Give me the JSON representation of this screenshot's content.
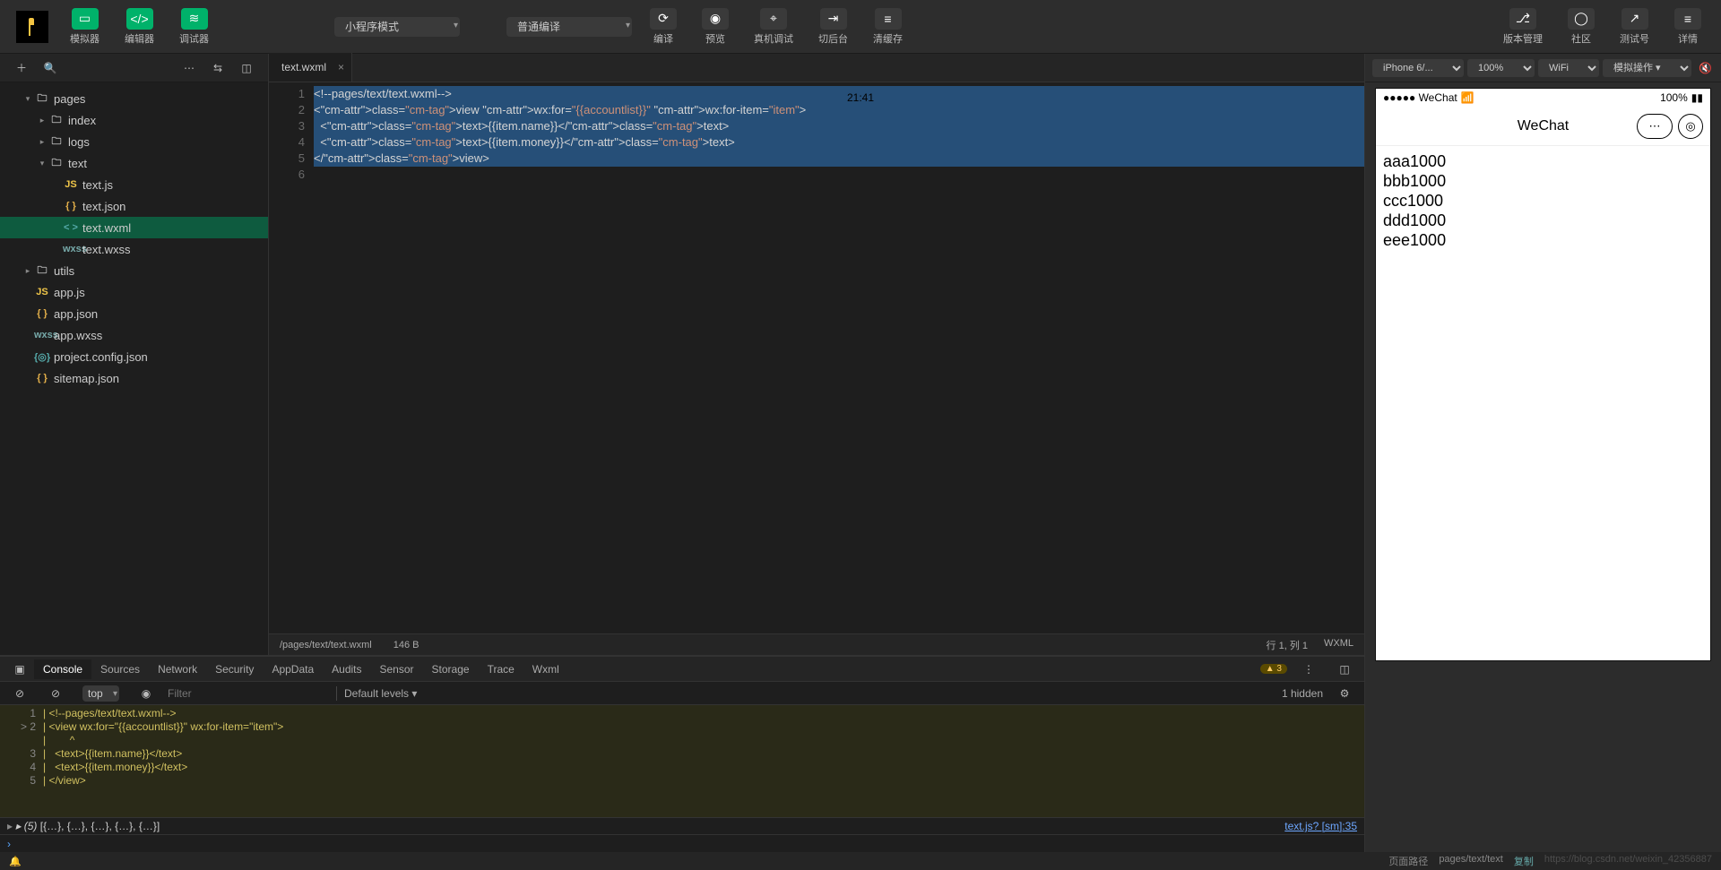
{
  "toolbar": {
    "simulator": "模拟器",
    "editor": "编辑器",
    "debugger": "调试器",
    "mode": "小程序模式",
    "compile_mode": "普通编译",
    "compile": "编译",
    "preview": "预览",
    "real_debug": "真机调试",
    "cut_bg": "切后台",
    "clear_cache": "清缓存",
    "version": "版本管理",
    "community": "社区",
    "test_id": "测试号",
    "details": "详情"
  },
  "filebar": {
    "dots": "⋯"
  },
  "tree": {
    "items": [
      {
        "name": "pages",
        "type": "folder",
        "open": true,
        "depth": 1
      },
      {
        "name": "index",
        "type": "folder",
        "open": false,
        "depth": 2
      },
      {
        "name": "logs",
        "type": "folder",
        "open": false,
        "depth": 2
      },
      {
        "name": "text",
        "type": "folder",
        "open": true,
        "depth": 2
      },
      {
        "name": "text.js",
        "type": "js",
        "depth": 3
      },
      {
        "name": "text.json",
        "type": "json",
        "depth": 3
      },
      {
        "name": "text.wxml",
        "type": "wxml",
        "depth": 3,
        "selected": true
      },
      {
        "name": "text.wxss",
        "type": "wxss",
        "depth": 3
      },
      {
        "name": "utils",
        "type": "folder",
        "open": false,
        "depth": 1
      },
      {
        "name": "app.js",
        "type": "js",
        "depth": 1
      },
      {
        "name": "app.json",
        "type": "json",
        "depth": 1
      },
      {
        "name": "app.wxss",
        "type": "wxss",
        "depth": 1
      },
      {
        "name": "project.config.json",
        "type": "cfg",
        "depth": 1
      },
      {
        "name": "sitemap.json",
        "type": "json",
        "depth": 1
      }
    ]
  },
  "tab": {
    "name": "text.wxml"
  },
  "code_lines": [
    "1",
    "2",
    "3",
    "4",
    "5",
    "6"
  ],
  "code": {
    "l1": "<!--pages/text/text.wxml-->",
    "l2": "<view wx:for=\"{{accountlist}}\" wx:for-item=\"item\">",
    "l3": "  <text>{{item.name}}</text>",
    "l4": "  <text>{{item.money}}</text>",
    "l5": "</view>",
    "l6": ""
  },
  "status": {
    "path": "/pages/text/text.wxml",
    "size": "146 B",
    "pos": "行 1, 列 1",
    "lang": "WXML"
  },
  "devtabs": [
    "Console",
    "Sources",
    "Network",
    "Security",
    "AppData",
    "Audits",
    "Sensor",
    "Storage",
    "Trace",
    "Wxml"
  ],
  "devwarn": "▲ 3",
  "console_toolbar": {
    "context": "top",
    "filter_ph": "Filter",
    "levels": "Default levels ▾",
    "hidden": "1 hidden"
  },
  "console_code": [
    {
      "n": "1",
      "t": "<!--pages/text/text.wxml-->"
    },
    {
      "n": "> 2",
      "t": "<view wx:for=\"{{accountlist}}\" wx:for-item=\"item\">"
    },
    {
      "n": "",
      "t": "       ^"
    },
    {
      "n": "3",
      "t": "  <text>{{item.name}}</text>"
    },
    {
      "n": "4",
      "t": "  <text>{{item.money}}</text>"
    },
    {
      "n": "5",
      "t": "</view>"
    }
  ],
  "console_out": {
    "prefix": "▸ (5)",
    "body": "[{…}, {…}, {…}, {…}, {…}]",
    "src": "text.js? [sm]:35"
  },
  "sim": {
    "device": "iPhone 6/...",
    "zoom": "100%",
    "net": "WiFi",
    "ops": "模拟操作 ▾",
    "status_left": "●●●●● WeChat",
    "status_wifi": "📶",
    "status_time": "21:41",
    "status_batt": "100%",
    "title": "WeChat",
    "items": [
      {
        "name": "aaa",
        "money": "1000"
      },
      {
        "name": "bbb",
        "money": "1000"
      },
      {
        "name": "ccc",
        "money": "1000"
      },
      {
        "name": "ddd",
        "money": "1000"
      },
      {
        "name": "eee",
        "money": "1000"
      }
    ]
  },
  "footer": {
    "route_lbl": "页面路径",
    "route": "pages/text/text",
    "copy": "复制",
    "watermark": "https://blog.csdn.net/weixin_42356887"
  }
}
